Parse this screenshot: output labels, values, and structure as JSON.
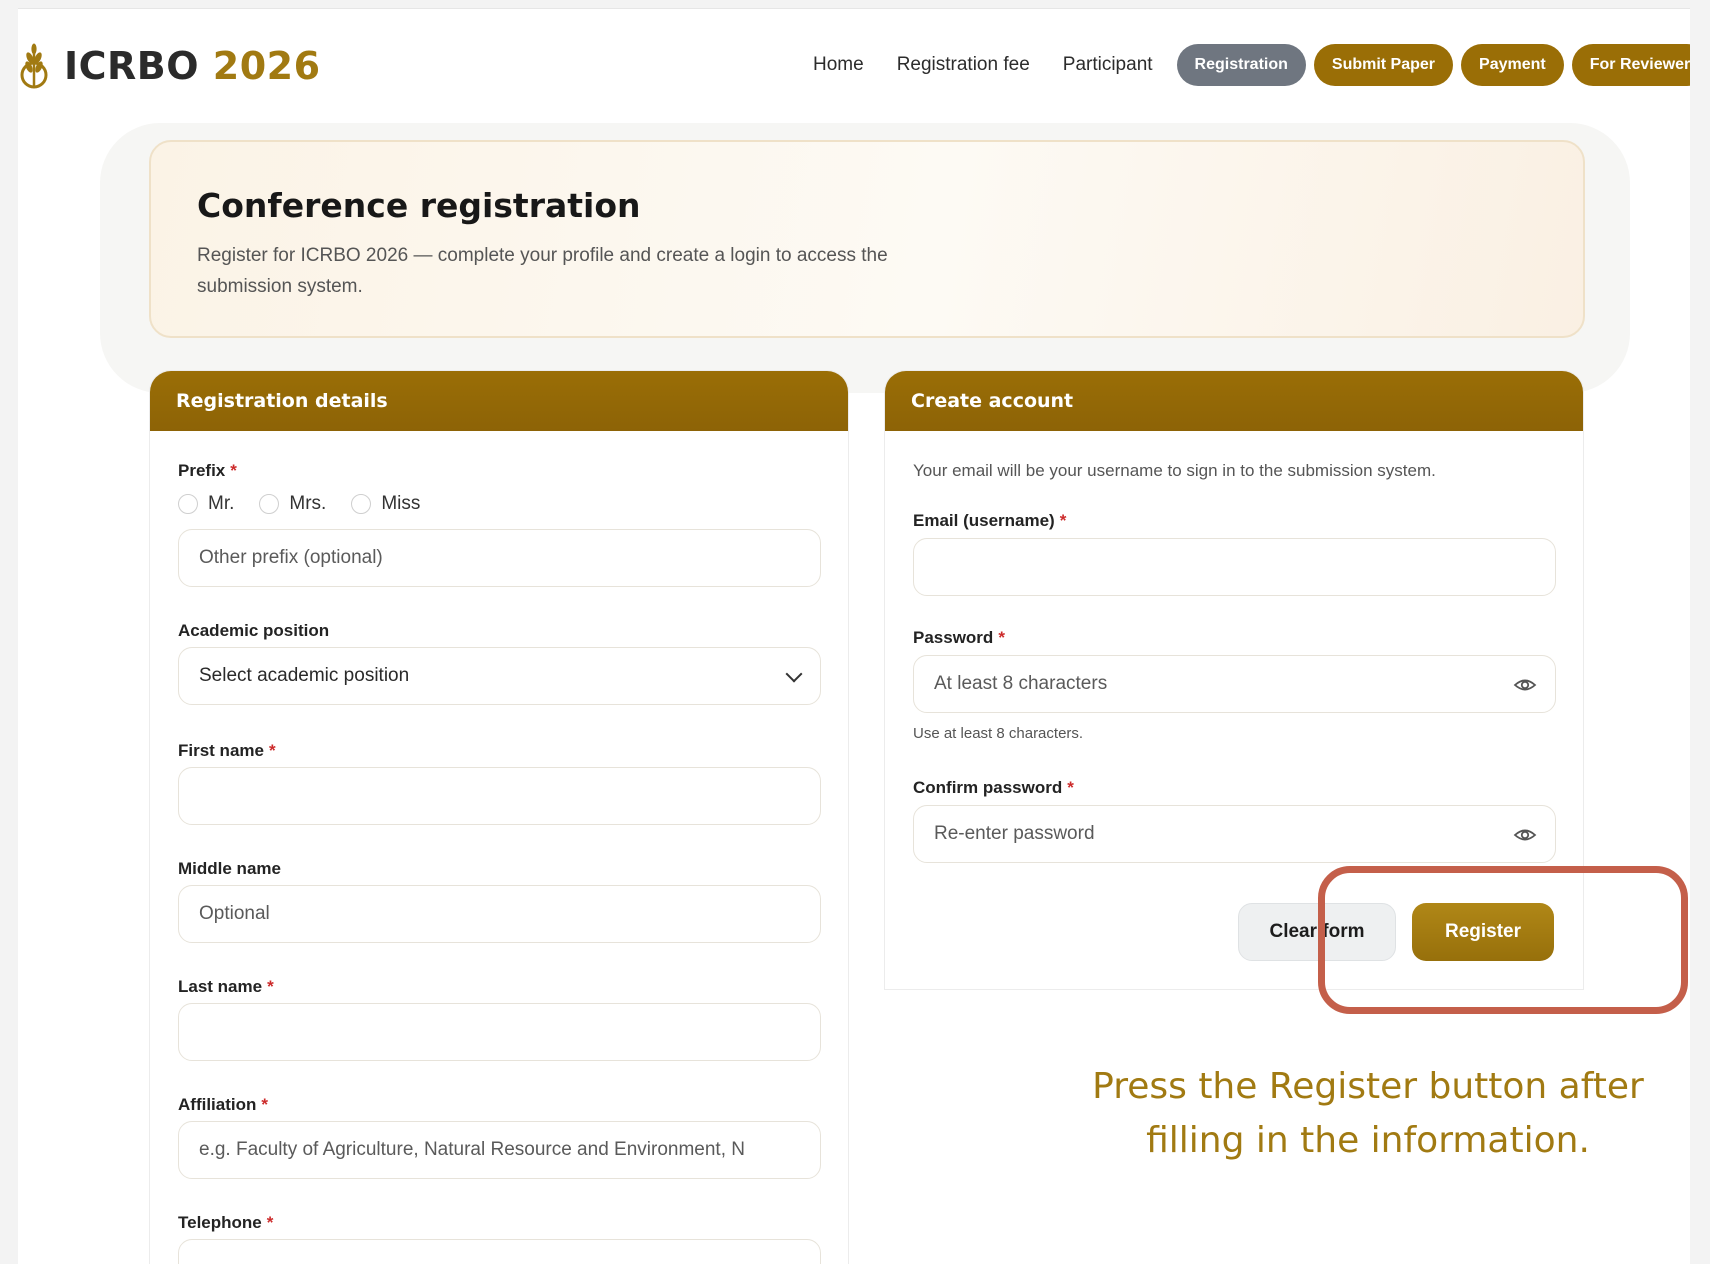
{
  "header": {
    "logo_acronym": "ICRBO",
    "logo_year": "2026",
    "nav": [
      {
        "label": "Home"
      },
      {
        "label": "Registration fee"
      },
      {
        "label": "Participant"
      }
    ],
    "pills": [
      {
        "label": "Registration",
        "active": true
      },
      {
        "label": "Submit Paper"
      },
      {
        "label": "Payment"
      },
      {
        "label": "For Reviewer"
      }
    ]
  },
  "hero": {
    "title": "Conference registration",
    "subtitle": "Register for ICRBO 2026 — complete your profile and create a login to access the submission system."
  },
  "registration": {
    "title": "Registration details",
    "prefix_label": "Prefix",
    "prefix_options": [
      "Mr.",
      "Mrs.",
      "Miss"
    ],
    "other_prefix_placeholder": "Other prefix (optional)",
    "academic_label": "Academic position",
    "academic_value": "Select academic position",
    "first_name_label": "First name",
    "first_name_value": "",
    "middle_name_label": "Middle name",
    "middle_name_placeholder": "Optional",
    "last_name_label": "Last name",
    "last_name_value": "",
    "affiliation_label": "Affiliation",
    "affiliation_placeholder": "e.g. Faculty of Agriculture, Natural Resource and Environment, N",
    "telephone_label": "Telephone",
    "required_mark": "*"
  },
  "account": {
    "title": "Create account",
    "note": "Your email will be your username to sign in to the submission system.",
    "email_label": "Email (username)",
    "email_value": "",
    "password_label": "Password",
    "password_placeholder": "At least 8 characters",
    "password_hint": "Use at least 8 characters.",
    "confirm_label": "Confirm password",
    "confirm_placeholder": "Re-enter password",
    "clear_label": "Clear form",
    "register_label": "Register"
  },
  "callout": {
    "text": "Press the Register button after filling in the information."
  },
  "colors": {
    "gold": "#9a6e06",
    "active_pill": "#6f7680",
    "highlight": "#c45f4a",
    "callout_text": "#a17a12"
  }
}
